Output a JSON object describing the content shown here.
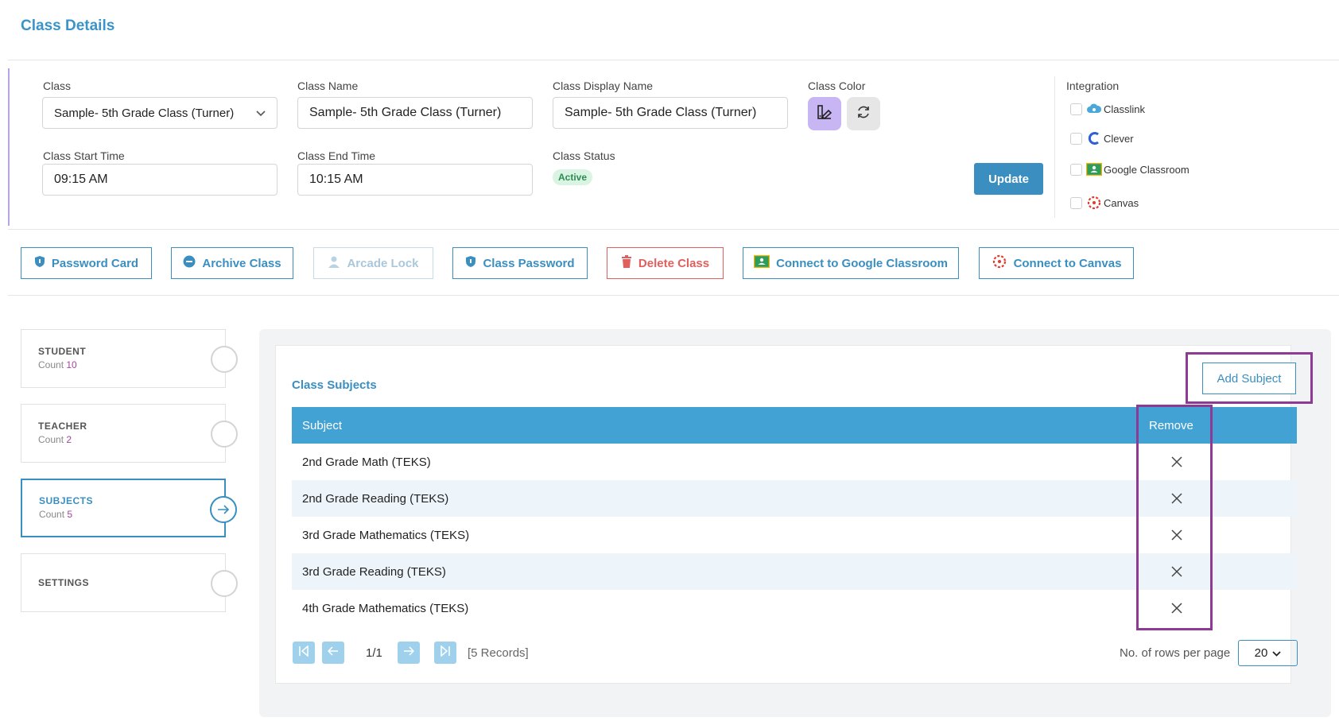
{
  "page": {
    "title": "Class Details"
  },
  "form": {
    "class_label": "Class",
    "class_value": "Sample- 5th Grade Class (Turner)",
    "class_name_label": "Class Name",
    "class_name_value": "Sample- 5th Grade Class (Turner)",
    "display_name_label": "Class Display Name",
    "display_name_value": "Sample- 5th Grade Class (Turner)",
    "color_label": "Class Color",
    "start_label": "Class Start Time",
    "start_value": "09:15 AM",
    "end_label": "Class End Time",
    "end_value": "10:15 AM",
    "status_label": "Class Status",
    "status_value": "Active",
    "update_label": "Update"
  },
  "integration": {
    "title": "Integration",
    "items": [
      {
        "label": "Classlink",
        "icon": "classlink-icon"
      },
      {
        "label": "Clever",
        "icon": "clever-icon"
      },
      {
        "label": "Google Classroom",
        "icon": "google-classroom-icon"
      },
      {
        "label": "Canvas",
        "icon": "canvas-icon"
      }
    ]
  },
  "actions": {
    "password_card": "Password Card",
    "archive_class": "Archive Class",
    "arcade_lock": "Arcade Lock",
    "class_password": "Class Password",
    "delete_class": "Delete Class",
    "connect_google": "Connect to Google Classroom",
    "connect_canvas": "Connect to Canvas"
  },
  "sidebar": {
    "count_label": "Count",
    "items": [
      {
        "title": "STUDENT",
        "count": "10"
      },
      {
        "title": "TEACHER",
        "count": "2"
      },
      {
        "title": "SUBJECTS",
        "count": "5"
      },
      {
        "title": "SETTINGS"
      }
    ]
  },
  "subjects": {
    "title": "Class Subjects",
    "add_label": "Add Subject",
    "col_subject": "Subject",
    "col_remove": "Remove",
    "rows": [
      "2nd Grade Math (TEKS)",
      "2nd Grade Reading (TEKS)",
      "3rd Grade Mathematics (TEKS)",
      "3rd Grade Reading (TEKS)",
      "4th Grade Mathematics (TEKS)"
    ]
  },
  "pagination": {
    "page_text": "1/1",
    "records": "[5 Records]",
    "rows_label": "No. of rows per page",
    "rows_value": "20"
  },
  "colors": {
    "accent": "#3a8fc0",
    "header": "#42a2d3",
    "highlight": "#8c3a93",
    "danger": "#e0605e",
    "class_color": "#c7b6f3"
  }
}
